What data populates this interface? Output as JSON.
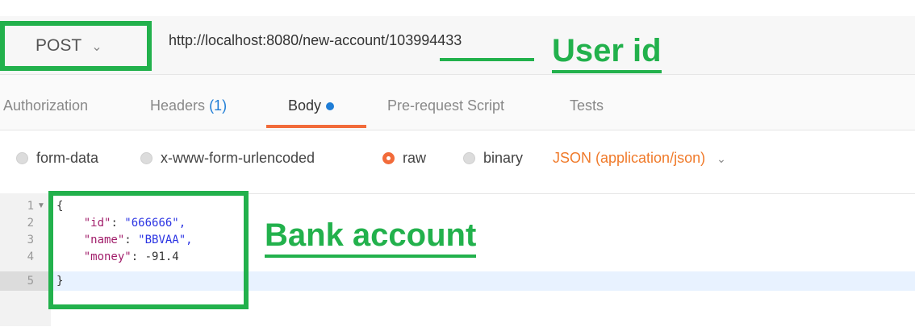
{
  "request": {
    "method": "POST",
    "url": "http://localhost:8080/new-account/103994433"
  },
  "tabs": [
    {
      "label": "Authorization"
    },
    {
      "label": "Headers",
      "count": "(1)"
    },
    {
      "label": "Body"
    },
    {
      "label": "Pre-request Script"
    },
    {
      "label": "Tests"
    }
  ],
  "body_types": [
    "form-data",
    "x-www-form-urlencoded",
    "raw",
    "binary"
  ],
  "content_type": "JSON (application/json)",
  "editor": {
    "line_numbers": [
      "1",
      "2",
      "3",
      "4",
      "5"
    ],
    "lines": [
      {
        "text": "{"
      },
      {
        "key": "\"id\"",
        "value": "\"666666\","
      },
      {
        "key": "\"name\"",
        "value": "\"BBVAA\","
      },
      {
        "key": "\"money\"",
        "value": "-91.4"
      },
      {
        "text": "}"
      }
    ]
  },
  "annotations": {
    "user_id_label": "User id",
    "bank_account_label": "Bank account"
  },
  "colors": {
    "accent": "#f26b3a",
    "highlight_green": "#22b14c",
    "link_blue": "#1f7dd6",
    "content_type": "#f07a2a"
  }
}
